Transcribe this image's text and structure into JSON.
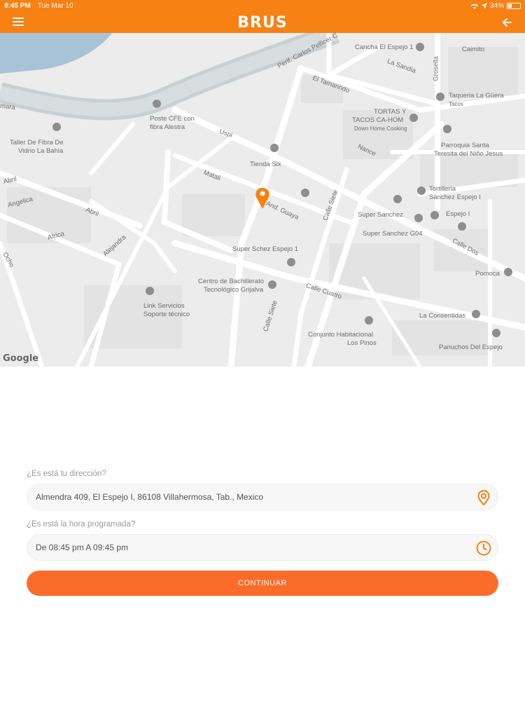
{
  "status_bar": {
    "time": "8:45 PM",
    "date": "Tue Mar 10",
    "battery": "34%",
    "battery_level": 0.34
  },
  "header": {
    "logo": "BRUS",
    "menu_icon": "hamburger-icon",
    "back_icon": "arrow-left-icon",
    "accent_color": "#f78113"
  },
  "map": {
    "attribution": "Google",
    "pin_color": "#f78113",
    "labels": [
      "Cancha El Espejo 1",
      "Caimito",
      "La Sandia",
      "Grosella",
      "Perif. Carlos Pellicer C",
      "El Tamarindo",
      "Taqueria La Güera",
      "Tacos",
      "TORTAS Y",
      "TACOS CA-HOM",
      "Down Home Cooking",
      "Poste CFE con",
      "fibra Alestra",
      "Taller De Fibra De",
      "Vidrio La Bahia",
      "Uspi",
      "Nance",
      "Parroquia Santa",
      "Teresita del Niño Jesus",
      "Tienda Six",
      "Matali",
      "Abril",
      "Angelica",
      "Abril",
      "And. Guaya",
      "Tortilleria",
      "Sánchez Espejo I",
      "Super Sanchez",
      "Espejo I",
      "Super Sanchez G04",
      "Calle Siete",
      "Calle Dos",
      "Africa",
      "Alejandra",
      "Super Schez Espejo 1",
      "Ocho",
      "Pomoca",
      "Centro de Bachillerato",
      "Tecnológico Grijalva",
      "Calle Cuatro",
      "Link Servicios",
      "Soporte técnico",
      "Calle Siete",
      "La Consentidas",
      "Conjunto Habitacional",
      "Los Pinos",
      "Panuchos Del Espejo",
      "mara"
    ]
  },
  "form": {
    "address_label": "¿Es está tu dirección?",
    "address_value": "Almendra 409, El Espejo I, 86108 Villahermosa, Tab., Mexico",
    "address_icon": "location-pin-icon",
    "time_label": "¿Es está la hora programada?",
    "time_value": "De 08:45 pm A 09:45 pm",
    "time_icon": "clock-icon",
    "continue_label": "CONTINUAR",
    "button_color": "#fb6c2b"
  }
}
